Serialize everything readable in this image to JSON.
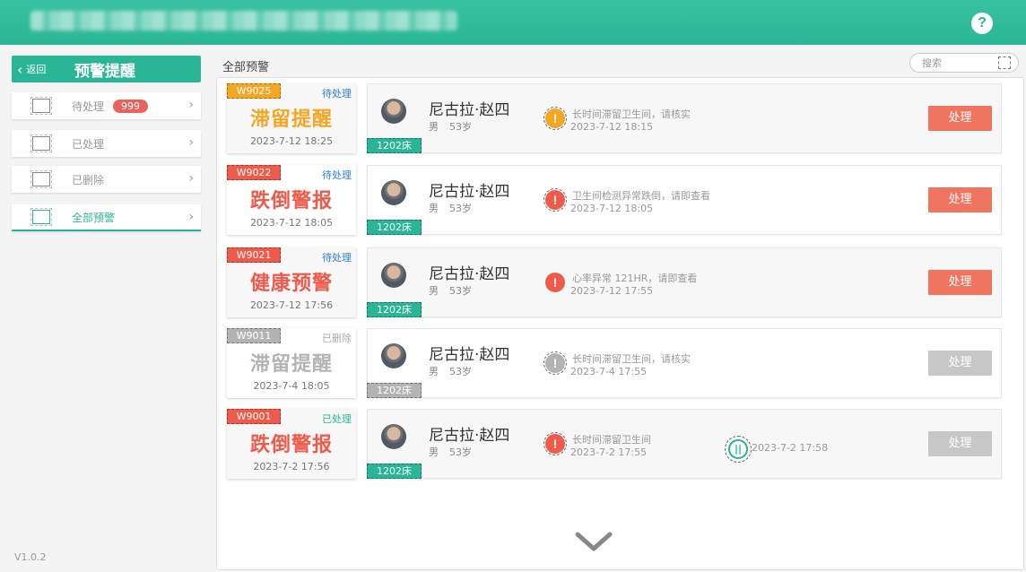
{
  "colors": {
    "accent": "#2ab696",
    "danger": "#ef5a4a",
    "warning": "#f5a623",
    "gray": "#b3b3b3",
    "btn_active": "#f07560",
    "btn_disabled": "#c7c7c7",
    "pending_blue": "#2d7fd5",
    "processed_green": "#2ab696"
  },
  "header": {
    "help_label": "?"
  },
  "sidebar": {
    "back_label": "返回",
    "title": "预警提醒",
    "items": [
      {
        "label": "待处理",
        "badge": "999",
        "icon": "inbox-icon"
      },
      {
        "label": "已处理",
        "icon": "checkbox-icon"
      },
      {
        "label": "已删除",
        "icon": "trash-icon"
      },
      {
        "label": "全部预警",
        "icon": "list-icon"
      }
    ],
    "version": "V1.0.2"
  },
  "main": {
    "section_title": "全部预警",
    "search_placeholder": "搜索",
    "alerts": [
      {
        "code": "W9025",
        "status": "待处理",
        "name": "滞留提醒",
        "time": "2023-7-12 18:25",
        "patient": "尼古拉·赵四",
        "gender": "男",
        "age": "53岁",
        "bed": "1202床",
        "icon": "!",
        "message": "长时间滞留卫生间，请核实",
        "message_time": "2023-7-12 18:15",
        "action": "处理"
      },
      {
        "code": "W9022",
        "status": "待处理",
        "name": "跌倒警报",
        "time": "2023-7-12 18:05",
        "patient": "尼古拉·赵四",
        "gender": "男",
        "age": "53岁",
        "bed": "1202床",
        "icon": "!",
        "message": "卫生间检测异常跌倒，请即查看",
        "message_time": "2023-7-12 18:05",
        "action": "处理"
      },
      {
        "code": "W9021",
        "status": "待处理",
        "name": "健康预警",
        "time": "2023-7-12 17:56",
        "patient": "尼古拉·赵四",
        "gender": "男",
        "age": "53岁",
        "bed": "1202床",
        "icon": "!",
        "message": "心率异常   121HR，请即查看",
        "message_time": "2023-7-12 17:55",
        "action": "处理"
      },
      {
        "code": "W9011",
        "status": "已删除",
        "name": "滞留提醒",
        "time": "2023-7-4 18:05",
        "patient": "尼古拉·赵四",
        "gender": "男",
        "age": "53岁",
        "bed": "1202床",
        "icon": "!",
        "message": "长时间滞留卫生间，请核实",
        "message_time": "2023-7-4 17:55",
        "action": "处理"
      },
      {
        "code": "W9001",
        "status": "已处理",
        "name": "跌倒警报",
        "time": "2023-7-2 17:56",
        "patient": "尼古拉·赵四",
        "gender": "男",
        "age": "53岁",
        "bed": "1202床",
        "icon": "!",
        "message": "长时间滞留卫生间",
        "message_time": "2023-7-2 17:55",
        "action": "处理",
        "extra_icon": "||",
        "extra_time": "2023-7-2 17:58"
      }
    ]
  }
}
